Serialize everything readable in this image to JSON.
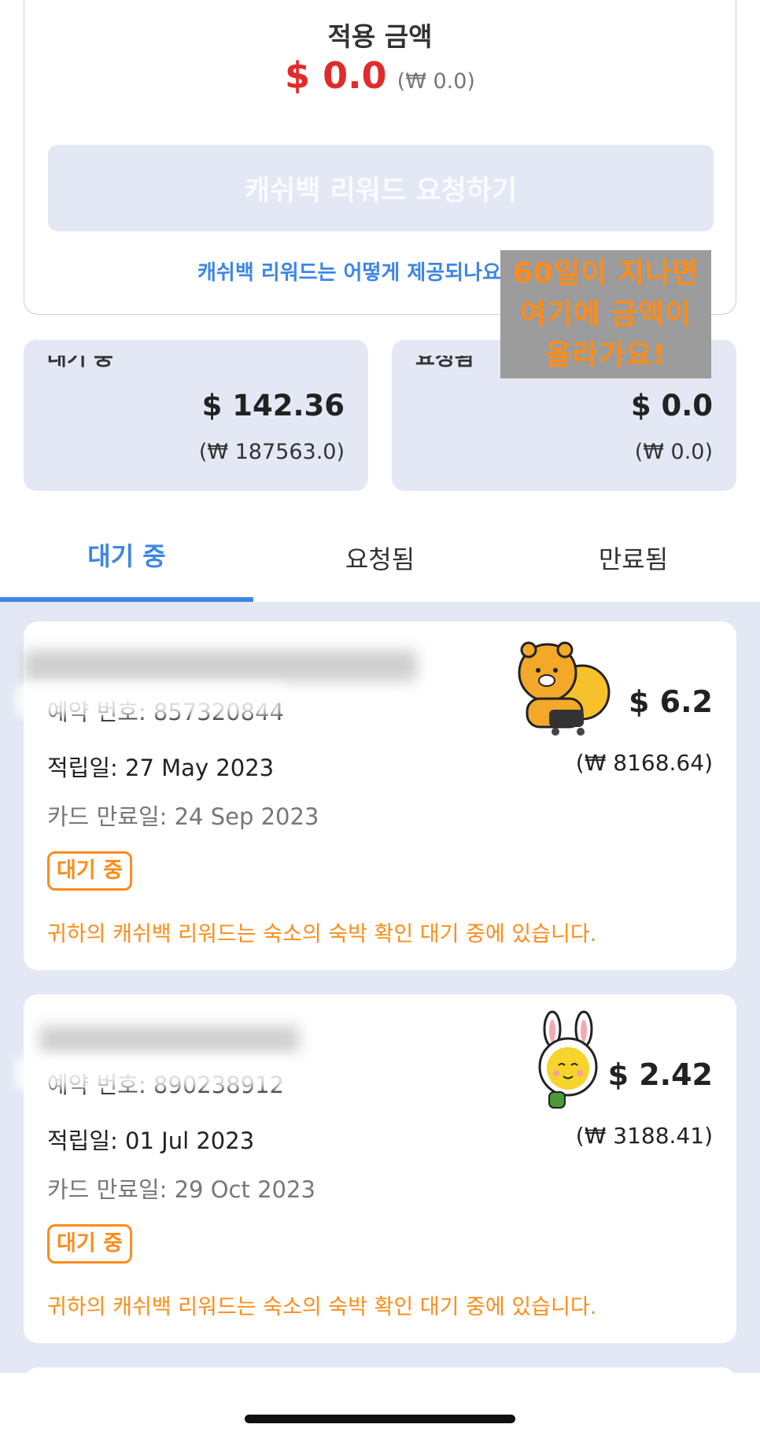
{
  "summary": {
    "title": "적용 금액",
    "usd": "$ 0.0",
    "krw": "(₩ 0.0)",
    "request_button": "캐쉬백 리워드 요청하기",
    "how_link": "캐쉬백 리워드는 어떻게 제공되나요?"
  },
  "stats": {
    "pending": {
      "label": "대기 중",
      "usd": "$ 142.36",
      "krw": "(₩ 187563.0)"
    },
    "requested": {
      "label": "요청됨",
      "usd": "$ 0.0",
      "krw": "(₩ 0.0)"
    }
  },
  "overlay_note": "60일이 지나면\n여기에 금액이\n올라가요!",
  "tabs": [
    {
      "label": "대기 중",
      "active": true
    },
    {
      "label": "요청됨",
      "active": false
    },
    {
      "label": "만료됨",
      "active": false
    }
  ],
  "items": [
    {
      "booking_no": "예약 번호: 857320844",
      "earned": "적립일: 27 May 2023",
      "card_expiry": "카드 만료일: 24 Sep 2023",
      "usd": "$ 6.2",
      "krw": "(₩ 8168.64)",
      "badge": "대기 중",
      "message": "귀하의 캐쉬백 리워드는 숙소의 숙박 확인 대기 중에 있습니다."
    },
    {
      "booking_no": "예약 번호: 890238912",
      "earned": "적립일: 01 Jul 2023",
      "card_expiry": "카드 만료일: 29 Oct 2023",
      "usd": "$ 2.42",
      "krw": "(₩ 3188.41)",
      "badge": "대기 중",
      "message": "귀하의 캐쉬백 리워드는 숙소의 숙박 확인 대기 중에 있습니다."
    }
  ],
  "colors": {
    "accent": "#3d86e6",
    "warning": "#ff8c1a",
    "danger": "#e22a2a",
    "panel": "#e4e8f4"
  },
  "icons": [
    "ryan-character-sticker",
    "ryan-bunny-character-sticker"
  ]
}
